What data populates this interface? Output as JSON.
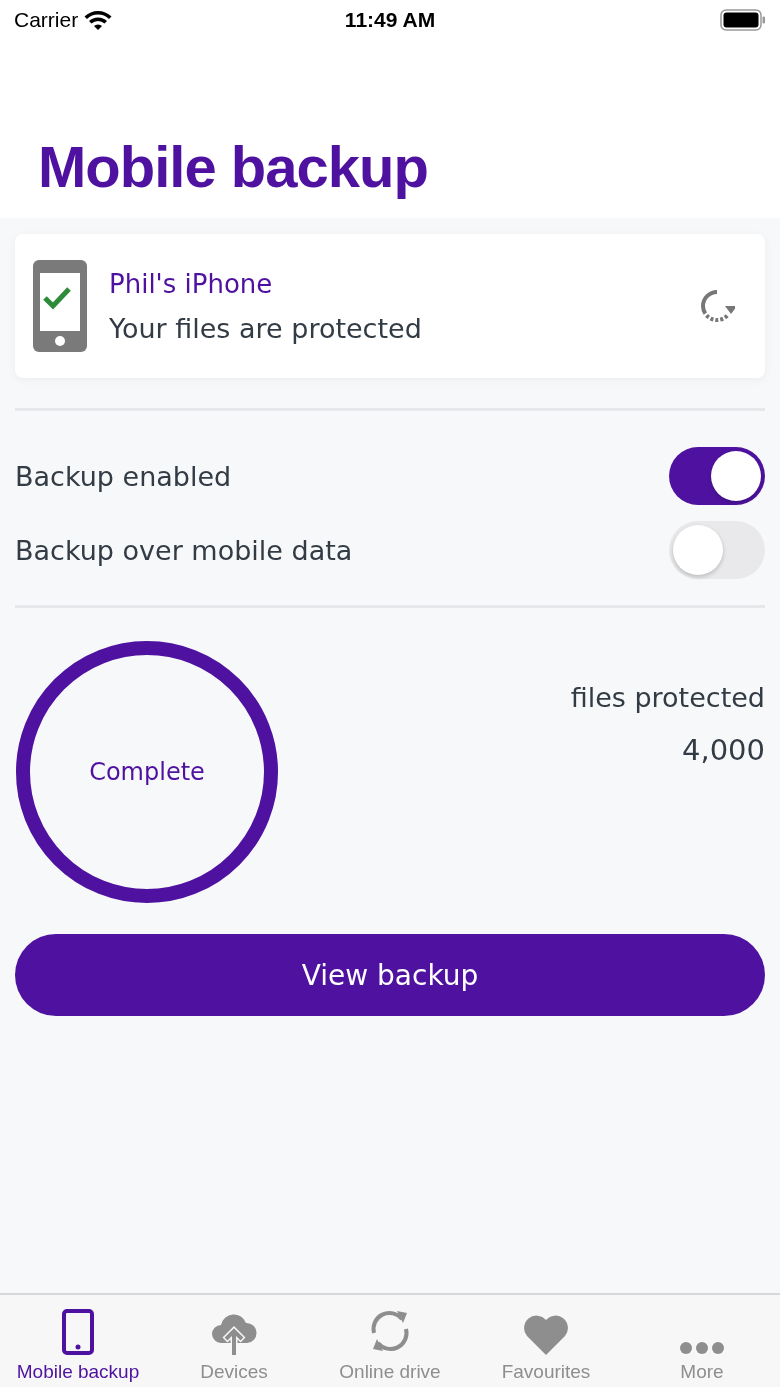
{
  "status_bar": {
    "carrier": "Carrier",
    "time": "11:49 AM"
  },
  "title": "Mobile backup",
  "device": {
    "name": "Phil's iPhone",
    "status": "Your files are protected"
  },
  "settings": [
    {
      "label": "Backup enabled",
      "on": true
    },
    {
      "label": "Backup over mobile data",
      "on": false
    }
  ],
  "progress": {
    "label": "Complete",
    "level": 1
  },
  "files": {
    "label": "files protected",
    "count": "4,000"
  },
  "primary_button": "View backup",
  "tabs": [
    {
      "label": "Mobile backup",
      "kind": "phone",
      "selected": true
    },
    {
      "label": "Devices",
      "kind": "cloud",
      "selected": false
    },
    {
      "label": "Online drive",
      "kind": "sync",
      "selected": false
    },
    {
      "label": "Favourites",
      "kind": "heart",
      "selected": false
    },
    {
      "label": "More",
      "kind": "more",
      "selected": false
    }
  ]
}
